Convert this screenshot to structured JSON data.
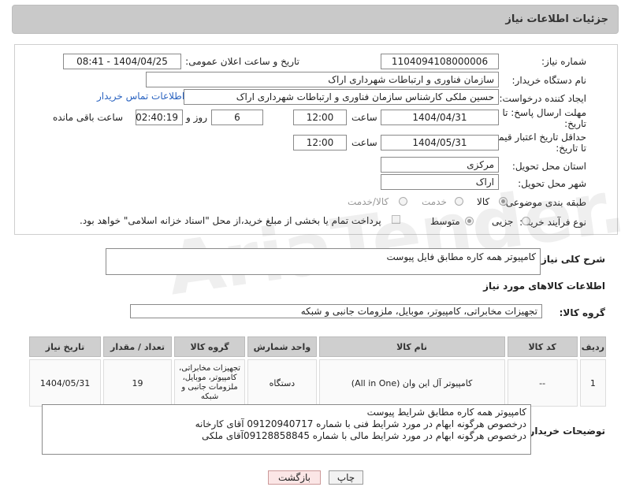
{
  "header": {
    "title": "جزئیات اطلاعات نیاز"
  },
  "fields": {
    "need_number_label": "شماره نیاز:",
    "need_number": "1104094108000006",
    "announce_label": "تاریخ و ساعت اعلان عمومی:",
    "announce_value": "1404/04/25 - 08:41",
    "buyer_org_label": "نام دستگاه خریدار:",
    "buyer_org": "سازمان فناوری و ارتباطات شهرداری اراک",
    "creator_label": "ایجاد کننده درخواست:",
    "creator": "حسین ملکی کارشناس سازمان فناوری و ارتباطات شهرداری اراک",
    "contact_link": "اطلاعات تماس خریدار",
    "deadline_label_1": "مهلت ارسال پاسخ: تا",
    "deadline_label_2": "تاریخ:",
    "deadline_date": "1404/04/31",
    "time_label": "ساعت",
    "deadline_time": "12:00",
    "days_value": "6",
    "days_label": "روز و",
    "remaining_time": "02:40:19",
    "remaining_label": "ساعت باقی مانده",
    "validity_label_1": "حداقل تاریخ اعتبار قیمت:",
    "validity_label_2": "تا تاریخ:",
    "validity_date": "1404/05/31",
    "validity_time": "12:00",
    "province_label": "استان محل تحویل:",
    "province": "مرکزی",
    "city_label": "شهر محل تحویل:",
    "city": "اراک",
    "category_label": "طبقه بندی موضوعی:",
    "cat_opt_goods": "کالا",
    "cat_opt_service": "خدمت",
    "cat_opt_both": "کالا/خدمت",
    "process_label": "نوع فرآیند خرید :",
    "proc_opt_partial": "جزیی",
    "proc_opt_medium": "متوسط",
    "payment_note": "پرداخت تمام یا بخشی از مبلغ خرید،از محل \"اسناد خزانه اسلامی\" خواهد بود."
  },
  "description": {
    "label": "شرح کلی نیاز:",
    "value": "کامپیوتر همه کاره مطابق فایل پیوست"
  },
  "goods_section": {
    "title": "اطلاعات کالاهای مورد نیاز"
  },
  "goods_group": {
    "label": "گروه کالا:",
    "value": "تجهیزات مخابراتی، کامپیوتر، موبایل، ملزومات جانبی و شبکه"
  },
  "table": {
    "headers": [
      "ردیف",
      "کد کالا",
      "نام کالا",
      "واحد شمارش",
      "گروه کالا",
      "تعداد / مقدار",
      "تاریخ نیاز"
    ],
    "rows": [
      [
        "1",
        "--",
        "کامپیوتر آل این وان (All in One)",
        "دستگاه",
        "تجهیزات مخابراتی، کامپیوتر، موبایل، ملزومات جانبی و شبکه",
        "19",
        "1404/05/31"
      ]
    ]
  },
  "buyer_notes": {
    "label": "توضیحات خریدار:",
    "lines": [
      "کامپیوتر همه کاره مطابق شرایط پیوست",
      "درخصوص هرگونه ابهام در مورد شرایط فنی با شماره 09120940717 آقای کارخانه",
      "درخصوص هرگونه ابهام در مورد شرایط مالی با شماره 09128858845آقای ملکی"
    ]
  },
  "buttons": {
    "print": "چاپ",
    "back": "بازگشت"
  },
  "watermark": "AriaTender.neT"
}
